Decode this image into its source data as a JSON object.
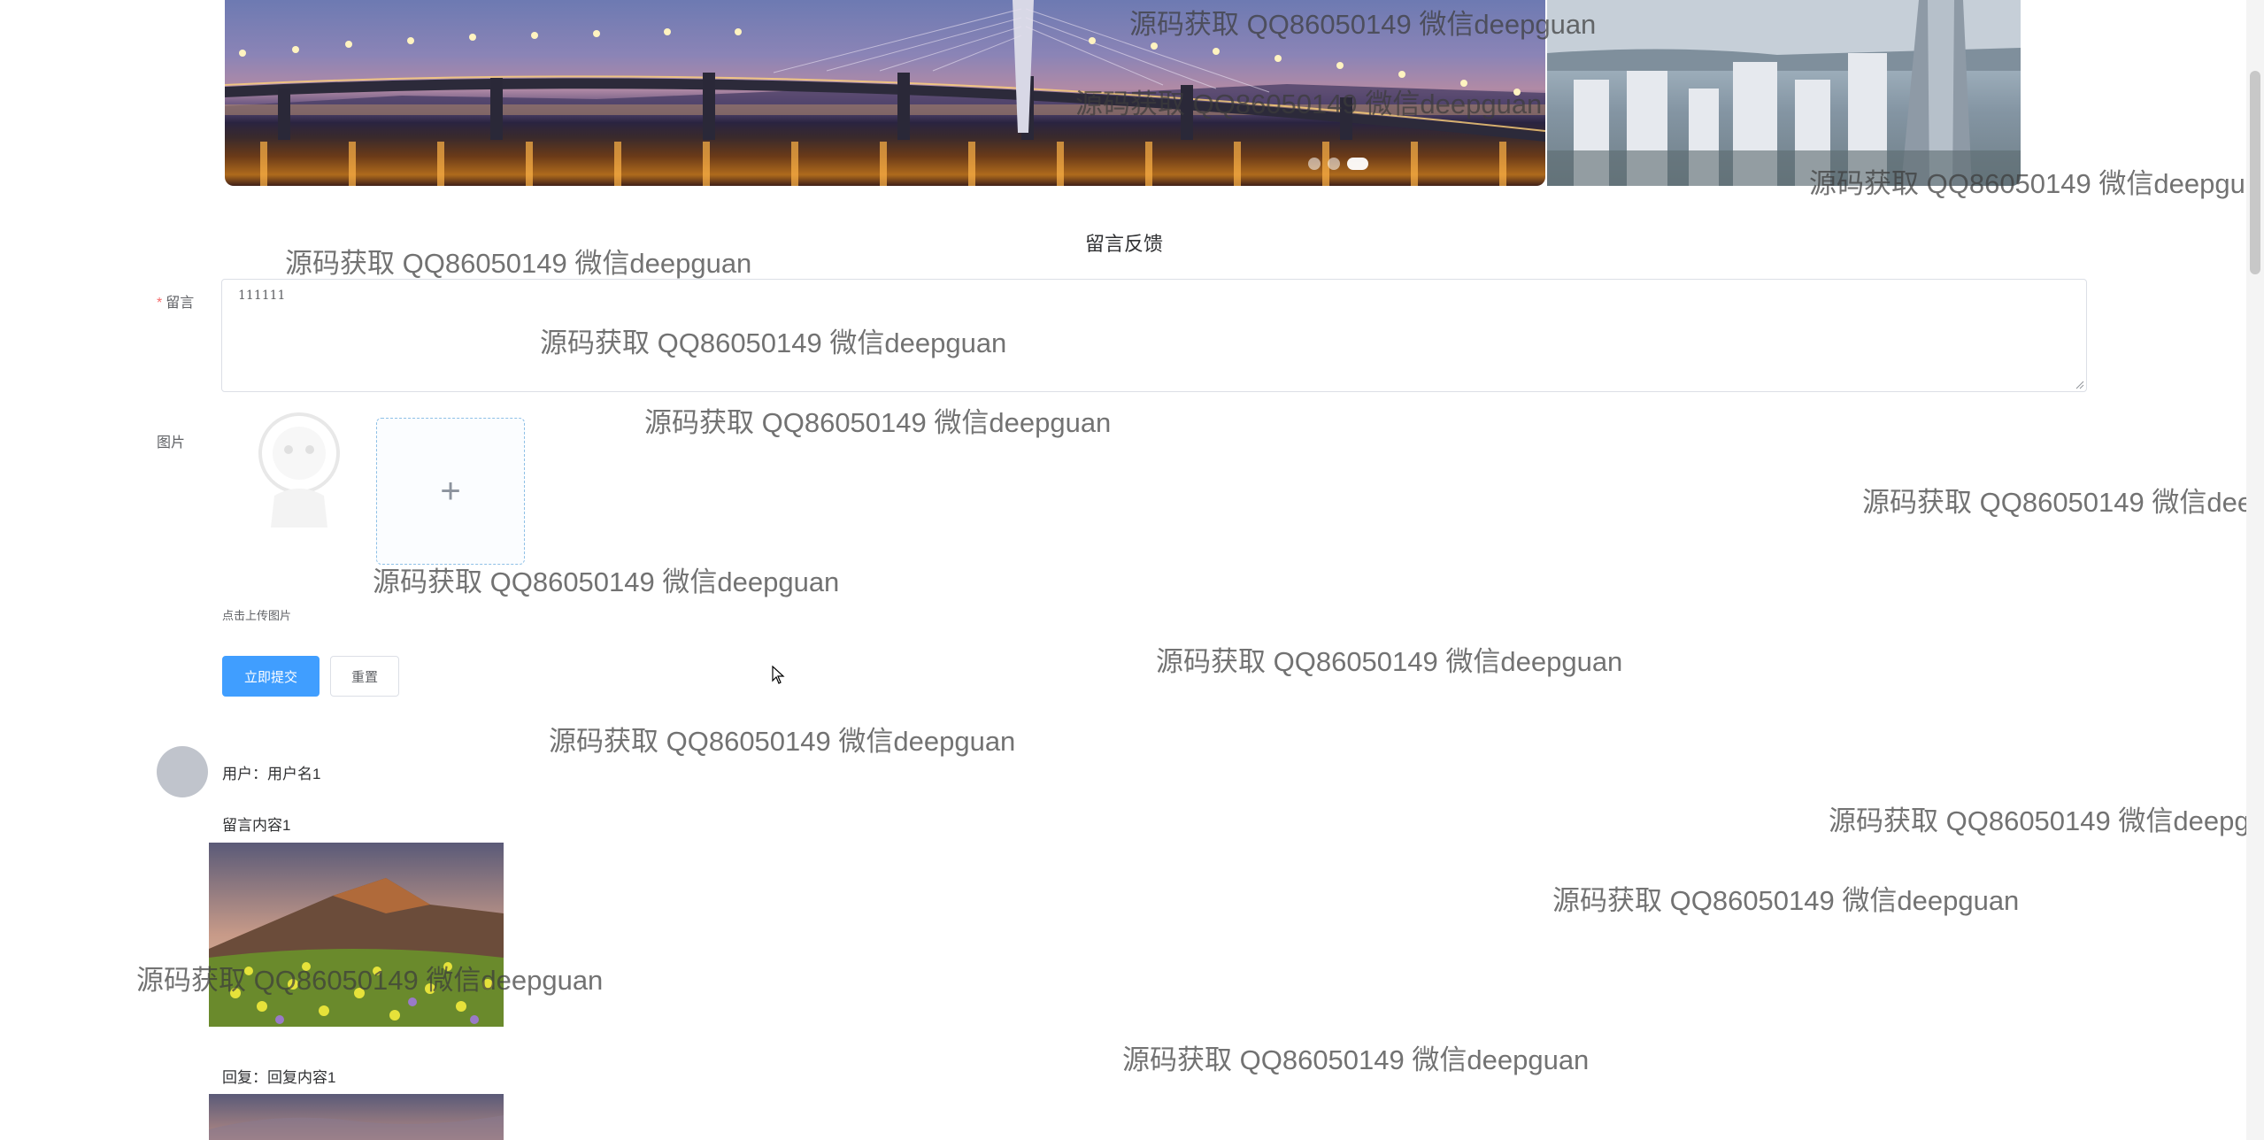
{
  "carousel": {
    "dots": 3,
    "active_dot": 3
  },
  "section": {
    "title": "留言反馈"
  },
  "form": {
    "message_label": "留言",
    "message_value": "111111",
    "image_label": "图片",
    "upload_plus": "+",
    "upload_tip": "点击上传图片",
    "submit_label": "立即提交",
    "reset_label": "重置"
  },
  "comments": [
    {
      "user": "用户：用户名1",
      "content": "留言内容1",
      "reply": "回复：回复内容1"
    }
  ],
  "watermark": {
    "text": "源码获取 QQ86050149 微信deepguan"
  },
  "colors": {
    "primary": "#409eff",
    "required": "#f56c6c",
    "avatar": "#c0c4cc"
  }
}
